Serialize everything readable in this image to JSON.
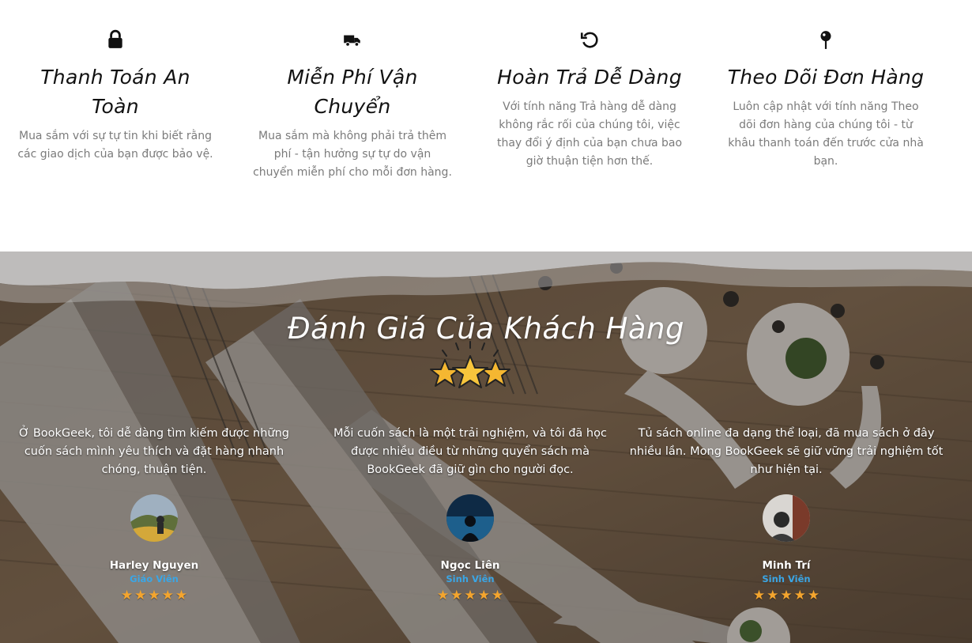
{
  "features": [
    {
      "icon": "lock-icon",
      "title": "Thanh Toán An Toàn",
      "description": "Mua sắm với sự tự tin khi biết rằng các giao dịch của bạn được bảo vệ."
    },
    {
      "icon": "truck-icon",
      "title": "Miễn Phí Vận Chuyển",
      "description": "Mua sắm mà không phải trả thêm phí - tận hưởng sự tự do vận chuyển miễn phí cho mỗi đơn hàng."
    },
    {
      "icon": "undo-icon",
      "title": "Hoàn Trả Dễ Dàng",
      "description": "Với tính năng Trả hàng dễ dàng không rắc rối của chúng tôi, việc thay đổi ý định của bạn chưa bao giờ thuận tiện hơn thế."
    },
    {
      "icon": "map-pin-icon",
      "title": "Theo Dõi Đơn Hàng",
      "description": "Luôn cập nhật với tính năng Theo dõi đơn hàng của chúng tôi - từ khâu thanh toán đến trước cửa nhà bạn."
    }
  ],
  "testimonials": {
    "title": "Đánh Giá Của Khách Hàng",
    "colors": {
      "role": "#3aa6e6",
      "star": "#f4a52e"
    },
    "items": [
      {
        "quote": "Ở BookGeek, tôi dễ dàng tìm kiếm được những cuốn sách mình yêu thích và đặt hàng nhanh chóng, thuận tiện.",
        "name": "Harley Nguyen",
        "role": "Giáo Viên",
        "rating": 5
      },
      {
        "quote": "Mỗi cuốn sách là một trải nghiệm, và tôi đã học được nhiều điều từ những quyển sách mà BookGeek đã giữ gìn cho người đọc.",
        "name": "Ngọc Liên",
        "role": "Sinh Viên",
        "rating": 5
      },
      {
        "quote": "Tủ sách online đa dạng thể loại, đã mua sách ở đây nhiều lần. Mong BookGeek sẽ giữ vững trải nghiệm tốt như hiện tại.",
        "name": "Minh Trí",
        "role": "Sinh Viên",
        "rating": 5
      }
    ]
  }
}
